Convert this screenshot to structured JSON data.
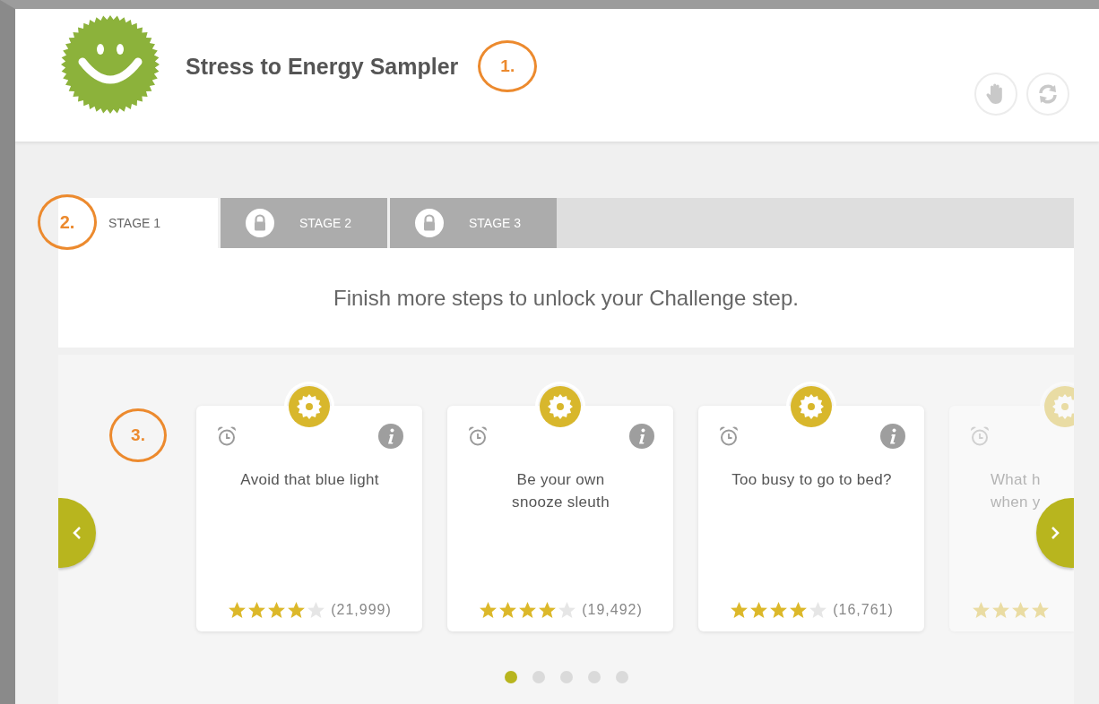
{
  "header": {
    "title": "Stress to Energy Sampler",
    "annotation": "1.",
    "actions": [
      {
        "kind": "hand"
      },
      {
        "kind": "refresh"
      }
    ]
  },
  "stages": {
    "annotation": "2.",
    "message": "Finish more steps to unlock your Challenge step.",
    "tabs": [
      {
        "label": "STAGE 1",
        "selected": true,
        "locked": false
      },
      {
        "label": "STAGE 2",
        "selected": false,
        "locked": true
      },
      {
        "label": "STAGE 3",
        "selected": false,
        "locked": true
      }
    ]
  },
  "carousel": {
    "annotation": "3.",
    "cards": [
      {
        "kind": "full",
        "title": "Avoid that blue light",
        "stars": 4,
        "count": "(21,999)"
      },
      {
        "kind": "full",
        "title": "Be your own\nsnooze sleuth",
        "stars": 4,
        "count": "(19,492)"
      },
      {
        "kind": "full",
        "title": "Too busy to go to bed?",
        "stars": 4,
        "count": "(16,761)"
      },
      {
        "kind": "partial",
        "title": "What h\nwhen y",
        "stars": 4
      }
    ],
    "dots": [
      {
        "selected": true
      },
      {
        "selected": false
      },
      {
        "selected": false
      },
      {
        "selected": false
      },
      {
        "selected": false
      }
    ]
  }
}
